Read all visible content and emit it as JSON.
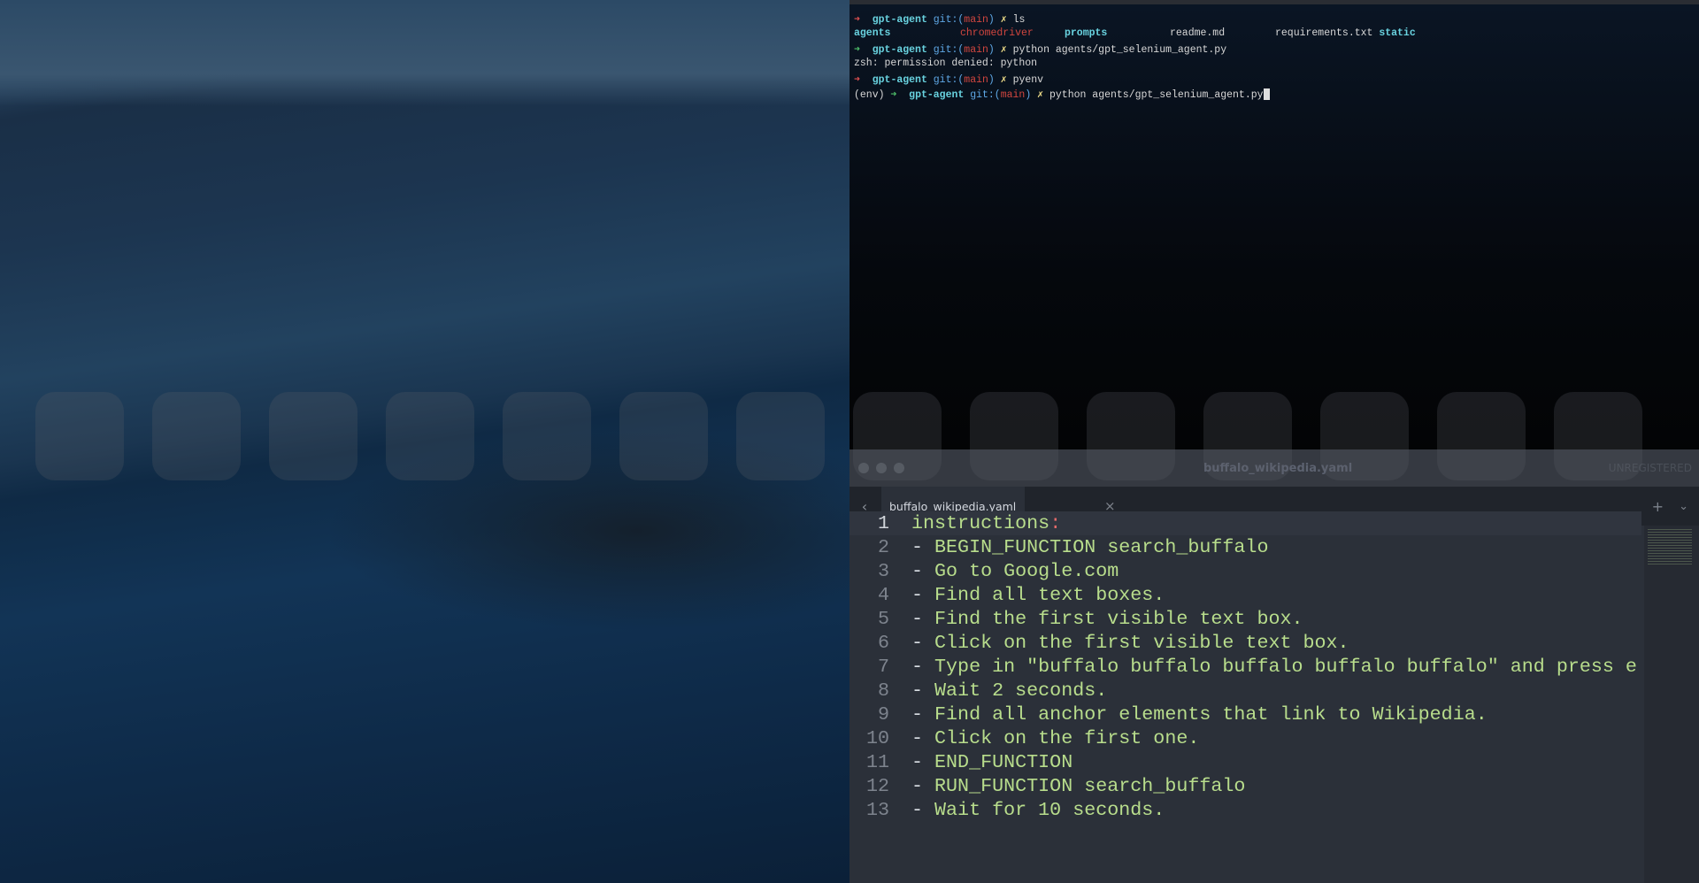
{
  "terminal": {
    "lines": [
      {
        "prompt_dir": "gpt-agent",
        "git": "git:(",
        "branch": "main",
        "git_end": ")",
        "mark": "✗",
        "cmd": "ls",
        "arrow": "➜"
      },
      {
        "listing": [
          "agents",
          "chromedriver",
          "prompts",
          "readme.md",
          "requirements.txt",
          "static"
        ]
      },
      {
        "prompt_dir": "gpt-agent",
        "git": "git:(",
        "branch": "main",
        "git_end": ")",
        "mark": "✗",
        "cmd": "python agents/gpt_selenium_agent.py",
        "arrow": "➜"
      },
      {
        "output": "zsh: permission denied: python"
      },
      {
        "prompt_dir": "gpt-agent",
        "git": "git:(",
        "branch": "main",
        "git_end": ")",
        "mark": "✗",
        "cmd": "pyenv",
        "arrow": "➜"
      },
      {
        "env": "(env)",
        "prompt_dir": "gpt-agent",
        "git": "git:(",
        "branch": "main",
        "git_end": ")",
        "mark": "✗",
        "cmd": "python agents/gpt_selenium_agent.py",
        "arrow": "➜"
      }
    ]
  },
  "editor": {
    "window_title": "buffalo_wikipedia.yaml",
    "unregistered": "UNREGISTERED",
    "tab": {
      "name": "buffalo_wikipedia.yaml",
      "close": "×"
    },
    "nav": {
      "back": "‹",
      "forward": "›",
      "plus": "+",
      "more": "⌄"
    },
    "lines": [
      {
        "n": "1",
        "text": "instructions",
        "colon": ":"
      },
      {
        "n": "2",
        "dash": "-",
        "text": " BEGIN_FUNCTION search_buffalo"
      },
      {
        "n": "3",
        "dash": "-",
        "text": " Go to Google.com"
      },
      {
        "n": "4",
        "dash": "-",
        "text": " Find all text boxes."
      },
      {
        "n": "5",
        "dash": "-",
        "text": " Find the first visible text box."
      },
      {
        "n": "6",
        "dash": "-",
        "text": " Click on the first visible text box."
      },
      {
        "n": "7",
        "dash": "-",
        "text": " Type in \"buffalo buffalo buffalo buffalo buffalo\" and press e"
      },
      {
        "n": "8",
        "dash": "-",
        "text": " Wait 2 seconds."
      },
      {
        "n": "9",
        "dash": "-",
        "text": " Find all anchor elements that link to Wikipedia."
      },
      {
        "n": "10",
        "dash": "-",
        "text": " Click on the first one."
      },
      {
        "n": "11",
        "dash": "-",
        "text": " END_FUNCTION"
      },
      {
        "n": "12",
        "dash": "-",
        "text": " RUN_FUNCTION search_buffalo"
      },
      {
        "n": "13",
        "dash": "-",
        "text": " Wait for 10 seconds."
      }
    ]
  }
}
